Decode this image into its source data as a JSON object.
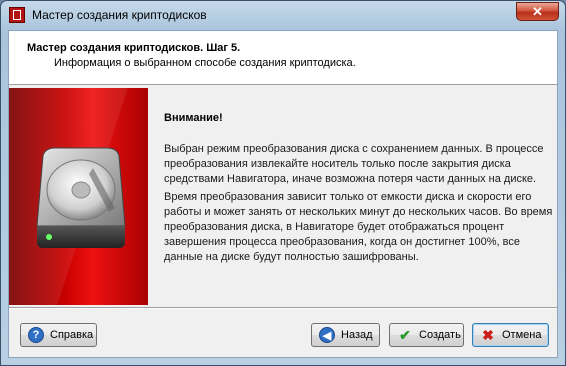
{
  "window": {
    "title": "Мастер создания криптодисков",
    "close_glyph": "✕"
  },
  "header": {
    "title": "Мастер создания криптодисков. Шаг 5.",
    "subtitle": "Информация о выбранном способе создания криптодиска."
  },
  "content": {
    "attention": "Внимание!",
    "paragraph1": "Выбран режим преобразования диска с сохранением данных. В процессе преобразования извлекайте носитель только после закрытия диска средствами Навигатора, иначе возможна потеря части данных на диске.",
    "paragraph2": "Время преобразования зависит только от емкости диска и скорости его работы и может занять от нескольких минут до нескольких часов. Во время преобразования диска, в Навигаторе будет отображаться процент завершения процесса преобразования, когда он достигнет 100%, все данные на диске будут полностью зашифрованы."
  },
  "buttons": {
    "help": "Справка",
    "back": "Назад",
    "create": "Создать",
    "cancel": "Отмена"
  },
  "icons": {
    "app": "crypto-disk-app-icon",
    "side_image": "hard-disk-icon",
    "help": "question-icon",
    "back": "back-arrow-icon",
    "create": "checkmark-icon",
    "cancel": "cross-icon"
  },
  "colors": {
    "side_panel": "#c80000",
    "title_bar": "#b9d0e3",
    "close_button": "#c8442c"
  }
}
